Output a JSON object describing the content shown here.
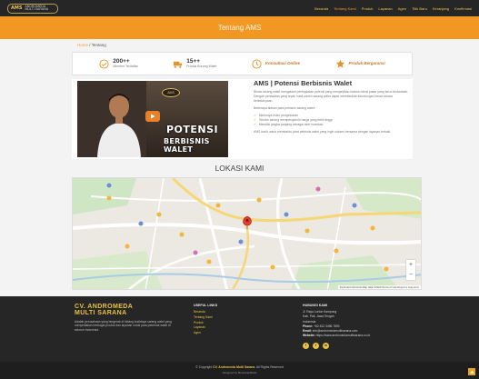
{
  "nav": {
    "logo_mark": "AMS",
    "logo_name": "ANDROMEDA MULTI SARANA",
    "links": [
      "Beranda",
      "Tentang Kami",
      "Produk",
      "Layanan",
      "Agen",
      "Titik Baru",
      "Keranjang",
      "Konfirmasi"
    ],
    "active_index": 1
  },
  "banner": {
    "title": "Tentang AMS"
  },
  "breadcrumb": {
    "home": "Home",
    "sep": " / ",
    "current": "Tentang"
  },
  "stats": [
    {
      "num": "200++",
      "label": "Member Terdaftar",
      "icon": "handshake-icon"
    },
    {
      "num": "15++",
      "label": "Produk Burung Walet",
      "icon": "truck-icon"
    },
    {
      "num": "",
      "label": "Konsultasi Online",
      "icon": "clock-icon"
    },
    {
      "num": "",
      "label": "Produk Bergaransi",
      "icon": "badge-icon"
    }
  ],
  "video": {
    "title1": "POTENSI",
    "title2": "BERBISNIS WALET",
    "badge": "AMS"
  },
  "article": {
    "title": "AMS | Potensi Berbisnis Walet",
    "p1": "Bisnis sarang walet mengalami peningkatan potensi yang menjanjikan karena minat pasar yang terus bertambah. Dengan perawatan yang tepat, hasil panen sarang walet dapat memberikan keuntungan besar secara berkelanjutan.",
    "p2": "Beberapa alasan para pebisnis sarang walet:",
    "items": [
      "Minimnya risiko pengeluaran",
      "Tekstur sarang mempengaruhi harga yang lebih tinggi",
      "Memiliki jangka panjang sebagai aset investasi"
    ],
    "p3": "AMS hadir untuk membantu para pebisnis walet yang ingin sukses bersama dengan layanan terbaik."
  },
  "lokasi": {
    "title": "LOKASI KAMI"
  },
  "map": {
    "marker_label": "Andromeda Multi Sarana",
    "zoom_in": "+",
    "zoom_out": "−",
    "credit": "Keyboard shortcuts  Map data ©2022  Terms of Use  Report a map error"
  },
  "footer": {
    "brand1": "CV. ANDROMEDA",
    "brand2": "MULTI SARANA",
    "desc": "Adalah perusahaan yang bergerak di bidang budidaya sarang walet yang menyediakan berbagai produk dan layanan untuk para peternak walet di seluruh Indonesia.",
    "col2_head": "USEFUL LINKS",
    "links": [
      "Beranda",
      "Tentang Kami",
      "Produk",
      "Layanan",
      "Agen"
    ],
    "col3_head": "HUBUNGI KAMI",
    "address1": "Jl. Raya Lontar Kampung",
    "address2": "Kab. Pati, Jawa Tengah",
    "address3": "Indonesia",
    "phone_label": "Phone:",
    "phone": "+62 812 3456 7890",
    "email_label": "Email:",
    "email": "info@andromedamultisarana.com",
    "website_label": "Website:",
    "website": "https://www.andromedamultisarana.co.id",
    "social": [
      "f",
      "t",
      "in"
    ]
  },
  "copyright": {
    "prefix": "© Copyright",
    "brand": "CV. Andromeda Multi Sarana",
    "suffix": ". All Rights Reserved",
    "designed": "Designed by BootstrapMade"
  }
}
